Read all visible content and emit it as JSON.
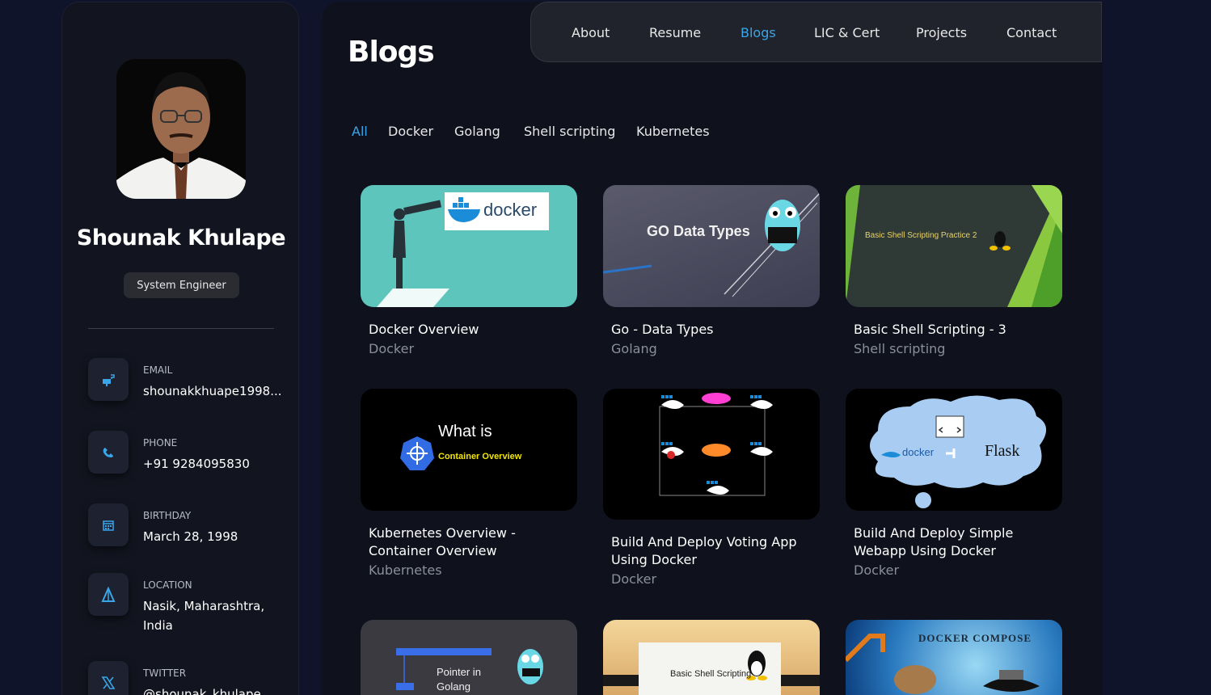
{
  "profile": {
    "name": "Shounak Khulape",
    "role": "System Engineer"
  },
  "contacts": [
    {
      "label": "Email",
      "value": "shounakkhuape1998...",
      "icon": "mailbox-icon"
    },
    {
      "label": "Phone",
      "value": "+91 9284095830",
      "icon": "phone-icon"
    },
    {
      "label": "Birthday",
      "value": "March 28, 1998",
      "icon": "calendar-icon"
    },
    {
      "label": "Location",
      "value": "Nasik, Maharashtra, India",
      "icon": "location-icon"
    },
    {
      "label": "Twitter",
      "value": "@shounak_khulape",
      "icon": "x-twitter-icon"
    }
  ],
  "nav": {
    "items": [
      "About",
      "Resume",
      "Blogs",
      "LIC & Cert",
      "Projects",
      "Contact"
    ],
    "active": "Blogs"
  },
  "page": {
    "title": "Blogs"
  },
  "filters": {
    "items": [
      "All",
      "Docker",
      "Golang",
      "Shell scripting",
      "Kubernetes"
    ],
    "active": "All"
  },
  "blogs": [
    {
      "title": "Docker Overview",
      "category": "Docker",
      "thumb_text": "docker"
    },
    {
      "title": "Go - Data Types",
      "category": "Golang",
      "thumb_text": "GO Data Types"
    },
    {
      "title": "Basic Shell Scripting - 3",
      "category": "Shell scripting",
      "thumb_text": "Basic Shell Scripting Practice 2"
    },
    {
      "title": "Kubernetes Overview - Container Overview",
      "category": "Kubernetes",
      "thumb_text": "What is",
      "thumb_sub": "Container Overview"
    },
    {
      "title": "Build And Deploy Voting App Using Docker",
      "category": "Docker",
      "thumb_text": ""
    },
    {
      "title": "Build And Deploy Simple Webapp Using Docker",
      "category": "Docker",
      "thumb_text": "Flask",
      "thumb_sub": "docker"
    },
    {
      "title": "",
      "category": "",
      "thumb_text": "Pointer in Golang"
    },
    {
      "title": "",
      "category": "",
      "thumb_text": "Basic Shell Scripting"
    },
    {
      "title": "",
      "category": "",
      "thumb_text": "DOCKER COMPOSE"
    }
  ],
  "colors": {
    "accent": "#38a6e8",
    "background": "#10142a",
    "card": "#12151f"
  }
}
